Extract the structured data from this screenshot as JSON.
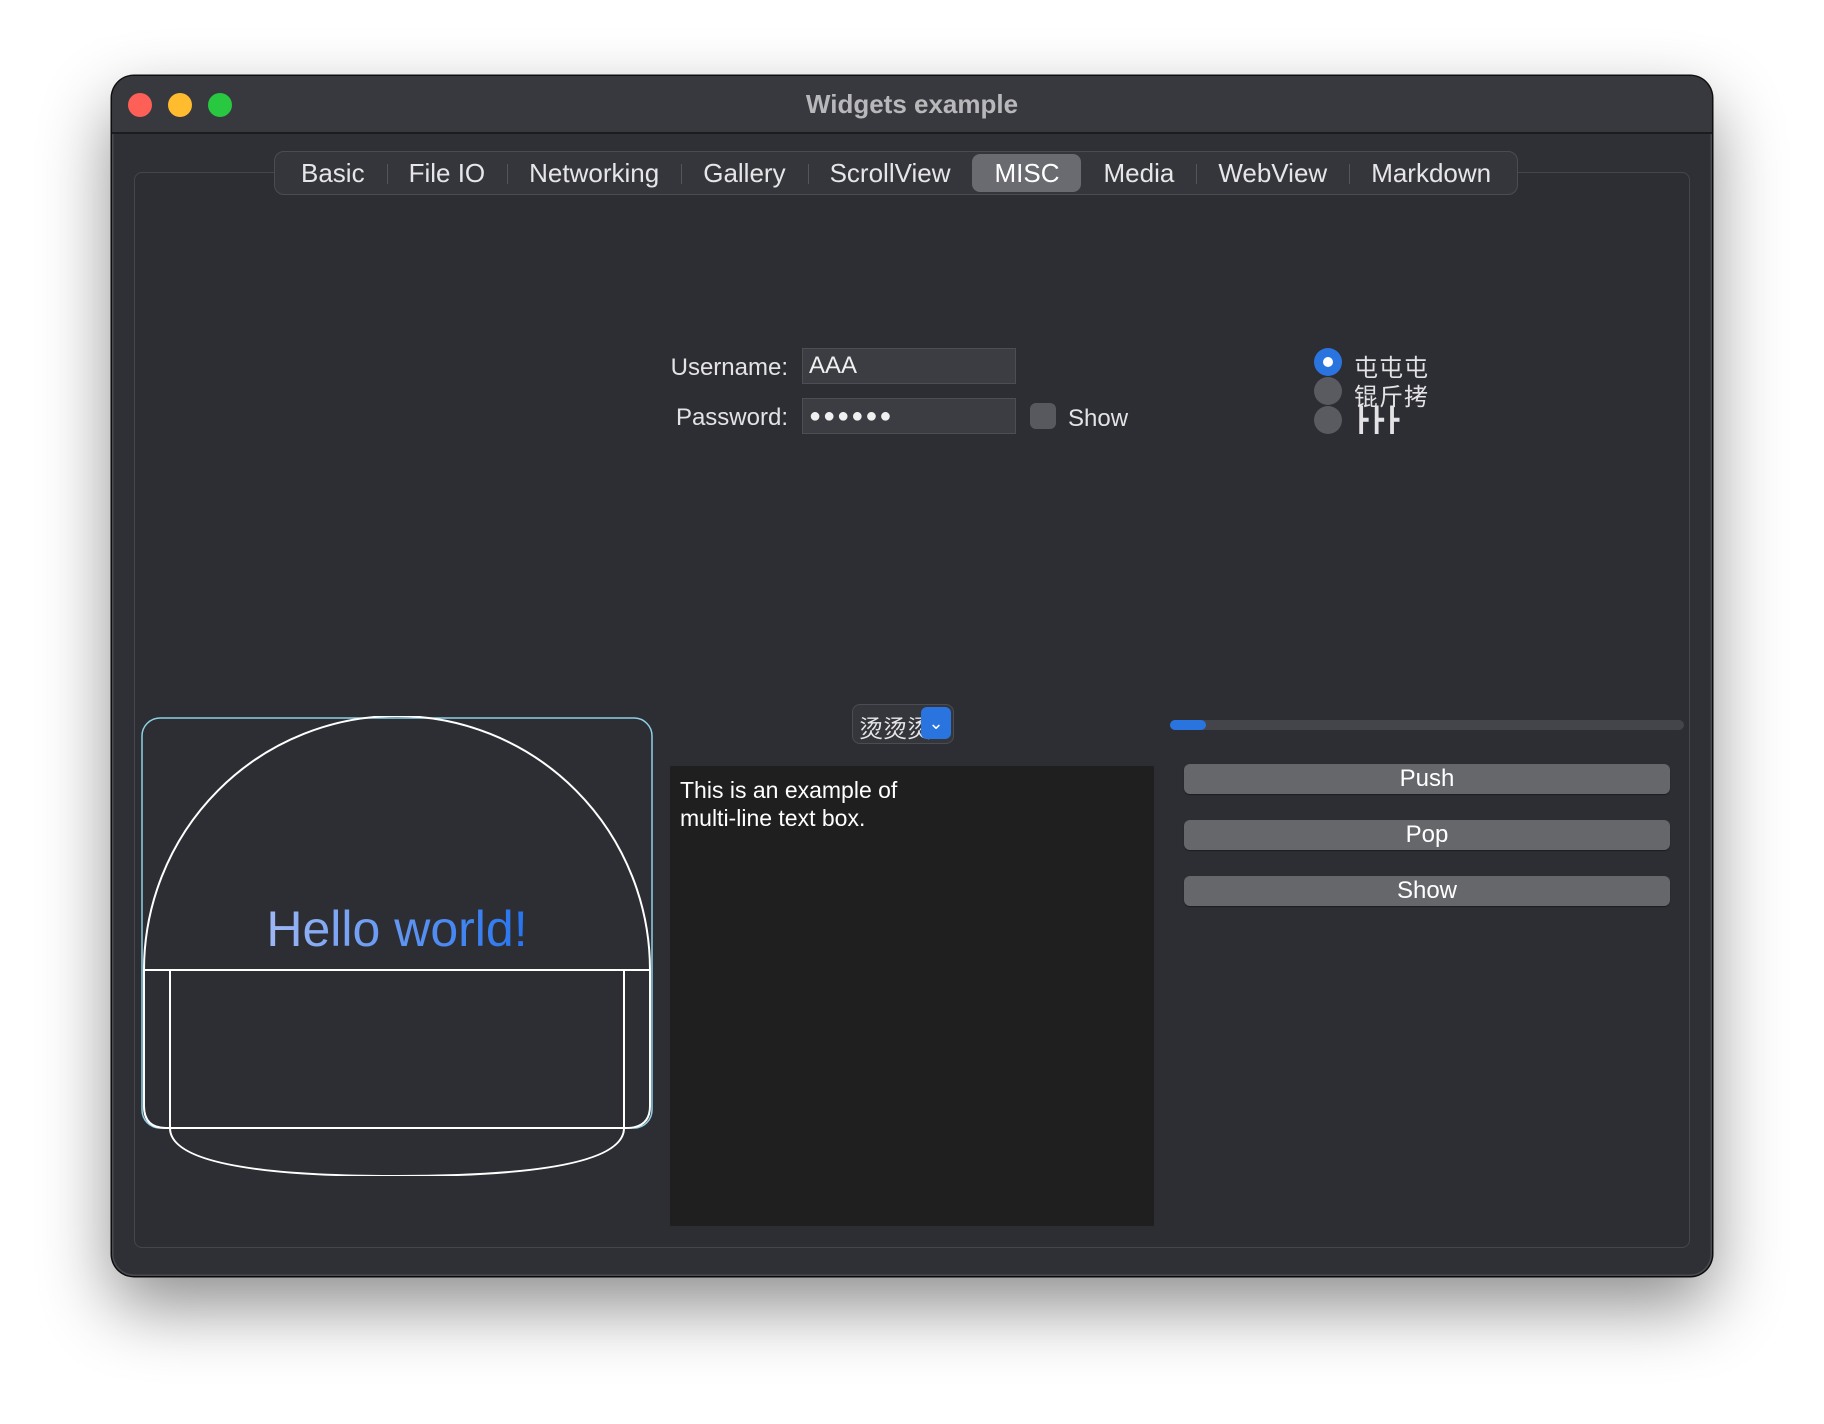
{
  "window": {
    "title": "Widgets example"
  },
  "tabs": [
    {
      "label": "Basic"
    },
    {
      "label": "File IO"
    },
    {
      "label": "Networking"
    },
    {
      "label": "Gallery"
    },
    {
      "label": "ScrollView"
    },
    {
      "label": "MISC",
      "active": true
    },
    {
      "label": "Media"
    },
    {
      "label": "WebView"
    },
    {
      "label": "Markdown"
    }
  ],
  "form": {
    "username_label": "Username:",
    "username_value": "AAA",
    "password_label": "Password:",
    "password_value": "●●●●●●",
    "show_label": "Show",
    "show_checked": false
  },
  "radios": [
    {
      "label": "屯屯屯",
      "checked": true
    },
    {
      "label": "锟斤拷",
      "checked": false
    },
    {
      "label": "┣┣┣",
      "checked": false
    }
  ],
  "combo": {
    "selected": "烫烫烫"
  },
  "progress": {
    "value": 0.07
  },
  "textbox": {
    "text": "This is an example of\nmulti-line text box."
  },
  "buttons": {
    "push": "Push",
    "pop": "Pop",
    "show": "Show"
  },
  "canvas": {
    "text_part1": "Hello w",
    "text_part2": "orld!"
  },
  "colors": {
    "accent": "#2a74e0",
    "window_bg": "#2f3035",
    "hello_gradient_start": "#9fb8f5",
    "hello_gradient_end": "#2474f0"
  }
}
